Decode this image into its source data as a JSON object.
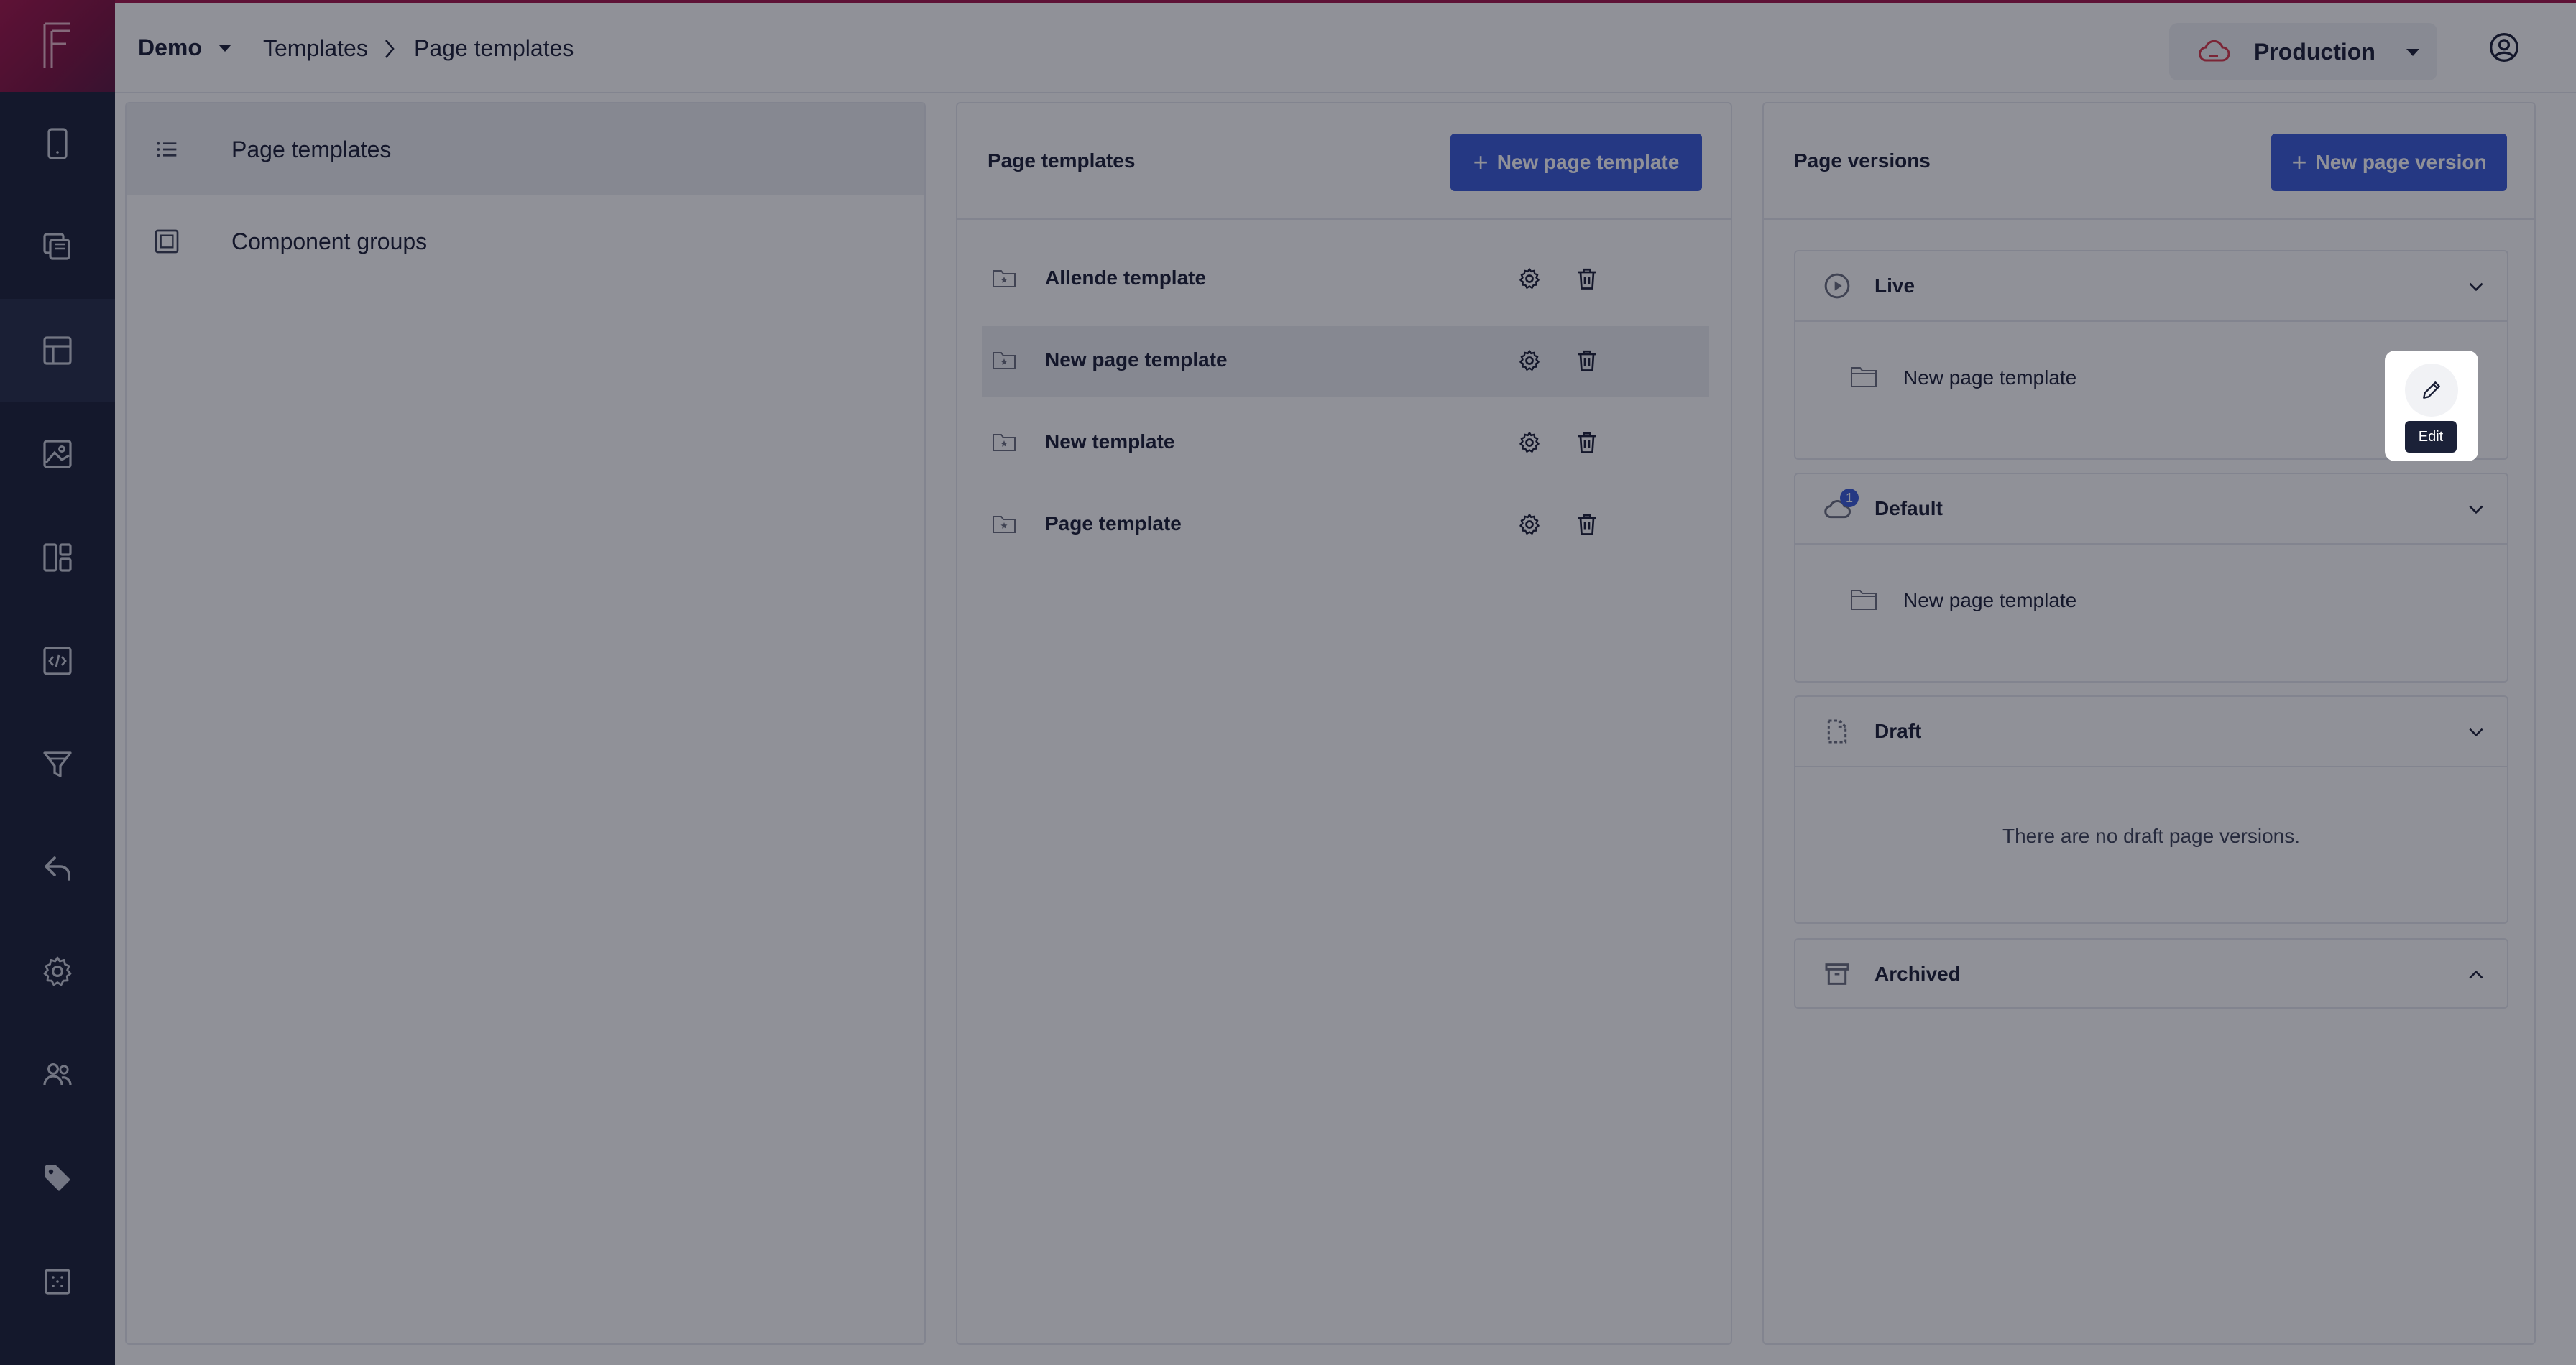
{
  "app": {
    "logo_letter": "F",
    "workspace": "Demo",
    "breadcrumb": [
      "Templates",
      "Page templates"
    ],
    "environment": "Production"
  },
  "rail": {
    "items": [
      {
        "icon": "mobile-icon"
      },
      {
        "icon": "copy-icon"
      },
      {
        "icon": "layout-icon",
        "active": true
      },
      {
        "icon": "image-icon"
      },
      {
        "icon": "dashboard-icon"
      },
      {
        "icon": "code-icon"
      },
      {
        "icon": "funnel-icon"
      },
      {
        "icon": "reply-icon"
      },
      {
        "icon": "gear-icon"
      },
      {
        "icon": "users-icon"
      },
      {
        "icon": "tag-icon"
      },
      {
        "icon": "grid-icon"
      }
    ]
  },
  "nav": {
    "items": [
      {
        "label": "Page templates",
        "icon": "list-icon",
        "active": true
      },
      {
        "label": "Component groups",
        "icon": "square-icon",
        "active": false
      }
    ]
  },
  "templates": {
    "title": "Page templates",
    "new_button": "New page template",
    "rows": [
      {
        "name": "Allende template",
        "active": false
      },
      {
        "name": "New page template",
        "active": true
      },
      {
        "name": "New template",
        "active": false
      },
      {
        "name": "Page template",
        "active": false
      }
    ]
  },
  "versions": {
    "title": "Page versions",
    "new_button": "New page version",
    "sections": {
      "live": {
        "title": "Live",
        "item": "New page template",
        "expanded": true
      },
      "default": {
        "title": "Default",
        "item": "New page template",
        "badge": "1",
        "expanded": true
      },
      "draft": {
        "title": "Draft",
        "empty": "There are no draft page versions.",
        "expanded": true
      },
      "archived": {
        "title": "Archived",
        "expanded": false
      }
    }
  },
  "tooltip": {
    "edit": "Edit"
  },
  "colors": {
    "rail": "#1b2138",
    "accent": "#a3154a",
    "primary": "#3a5bd9",
    "overlay": "rgba(12,16,30,0.46)"
  }
}
